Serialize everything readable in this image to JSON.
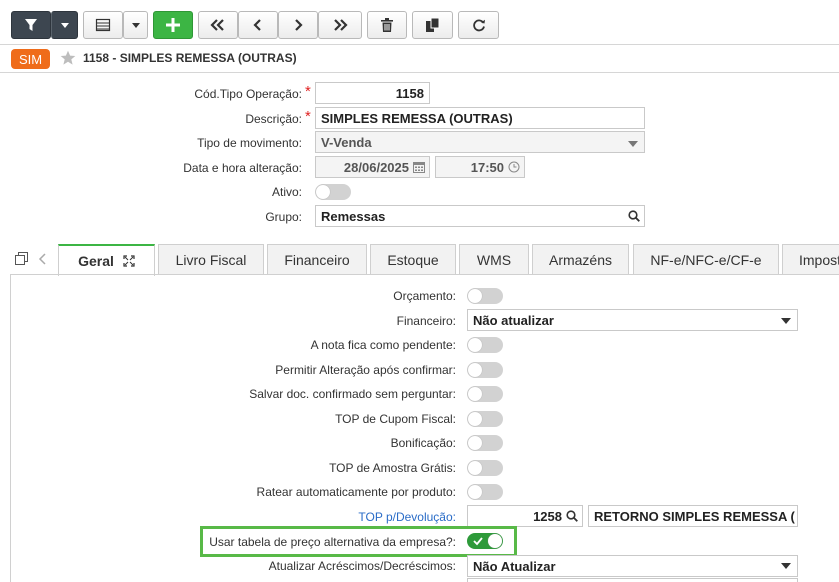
{
  "toolbar": {
    "buttons": [
      "filter-icon",
      "dropdown-caret",
      "table-view-icon",
      "dropdown-caret",
      "add-icon",
      "first-icon",
      "prev-icon",
      "next-icon",
      "last-icon",
      "delete-icon",
      "duplicate-icon",
      "refresh-icon"
    ]
  },
  "header": {
    "badge": "SIM",
    "title": "1158 - SIMPLES REMESSA (OUTRAS)"
  },
  "form": {
    "cod_tipo_label": "Cód.Tipo Operação:",
    "cod_tipo_value": "1158",
    "descricao_label": "Descrição:",
    "descricao_value": "SIMPLES REMESSA (OUTRAS)",
    "tipo_mov_label": "Tipo de movimento:",
    "tipo_mov_value": "V-Venda",
    "data_label": "Data e hora alteração:",
    "data_value": "28/06/2025",
    "hora_value": "17:50",
    "ativo_label": "Ativo:",
    "grupo_label": "Grupo:",
    "grupo_value": "Remessas"
  },
  "tabs": [
    {
      "label": "Geral"
    },
    {
      "label": "Livro Fiscal"
    },
    {
      "label": "Financeiro"
    },
    {
      "label": "Estoque"
    },
    {
      "label": "WMS"
    },
    {
      "label": "Armazéns"
    },
    {
      "label": "NF-e/NFC-e/CF-e"
    },
    {
      "label": "Impost"
    }
  ],
  "geral": {
    "orcamento": "Orçamento:",
    "financeiro": "Financeiro:",
    "financeiro_value": "Não atualizar",
    "nota_pendente": "A nota fica como pendente:",
    "permitir_alt": "Permitir Alteração após confirmar:",
    "salvar_doc": "Salvar doc. confirmado sem perguntar:",
    "top_cupom": "TOP de Cupom Fiscal:",
    "bonificacao": "Bonificação:",
    "top_amostra": "TOP de Amostra Grátis:",
    "ratear": "Ratear automaticamente por produto:",
    "top_devolucao": "TOP p/Devolução:",
    "top_devolucao_code": "1258",
    "top_devolucao_desc": "RETORNO SIMPLES REMESSA (",
    "usar_tabela": "Usar tabela de preço alternativa da empresa?:",
    "atualizar_acresc": "Atualizar Acréscimos/Decréscimos:",
    "atualizar_acresc_value": "Não Atualizar"
  },
  "colors": {
    "accent_green": "#3cb544",
    "badge_orange": "#ef6c1a",
    "highlight_box": "#58b947",
    "link_blue": "#2a6cc7"
  }
}
